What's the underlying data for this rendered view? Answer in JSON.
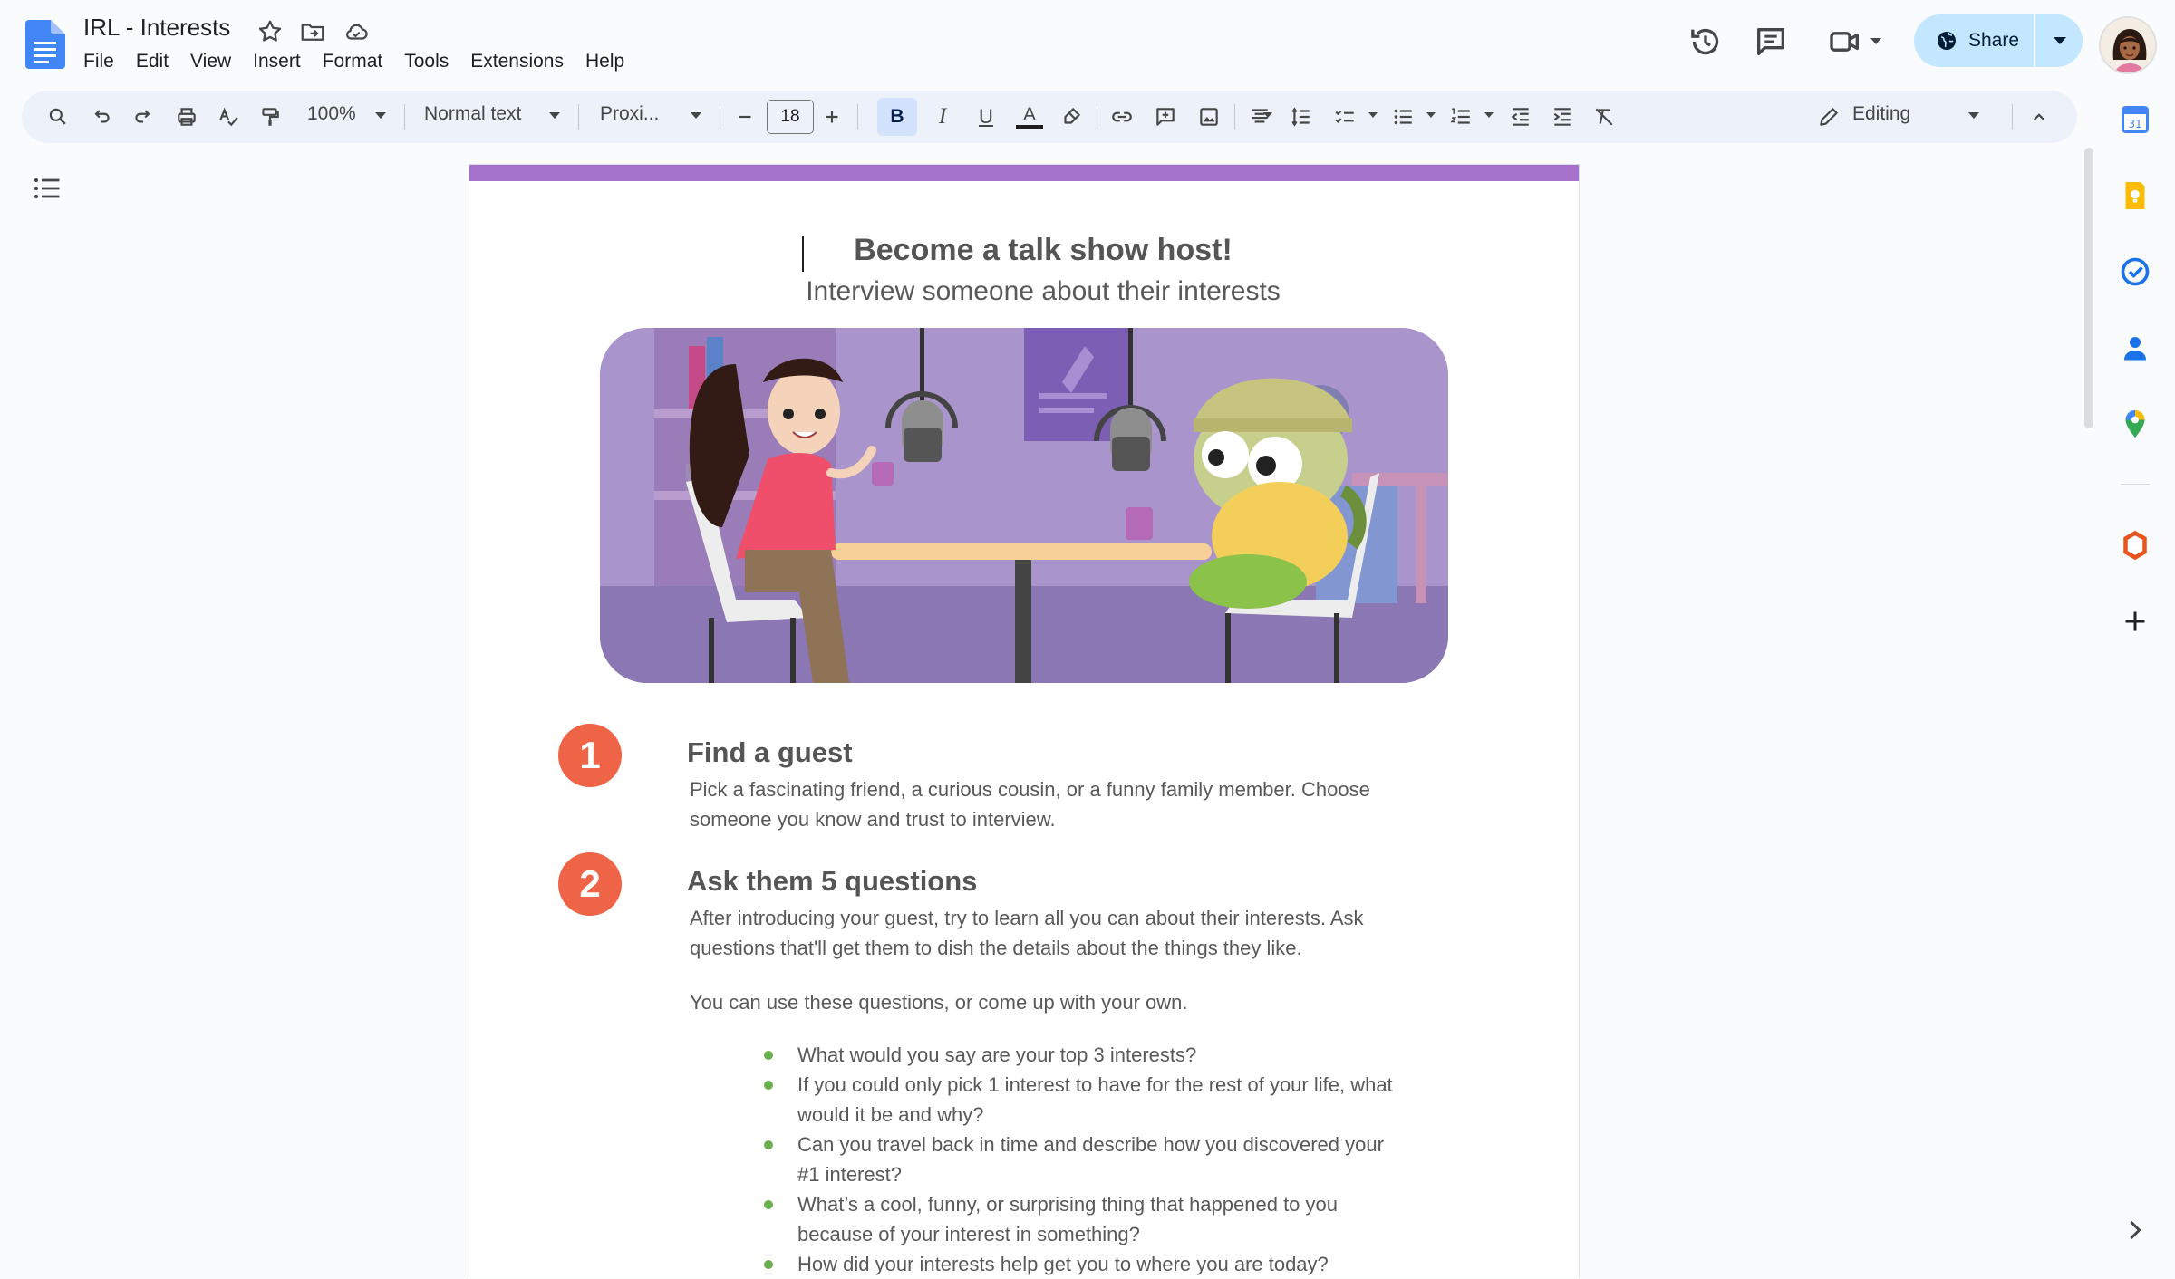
{
  "app": {
    "doc_title": "IRL - Interests",
    "menu": [
      "File",
      "Edit",
      "View",
      "Insert",
      "Format",
      "Tools",
      "Extensions",
      "Help"
    ],
    "share_label": "Share"
  },
  "toolbar": {
    "zoom": "100%",
    "style": "Normal text",
    "font": "Proxi...",
    "font_size": "18",
    "bold": "B",
    "italic": "I",
    "underline": "U",
    "text_color": "A",
    "mode": "Editing"
  },
  "document": {
    "heading": "Become a talk show host!",
    "subheading": "Interview someone about their interests",
    "steps": [
      {
        "number": "1",
        "title": "Find a guest",
        "lines": [
          "Pick a fascinating friend, a curious cousin, or a funny family member. Choose",
          "someone you know and trust to interview."
        ]
      },
      {
        "number": "2",
        "title": "Ask them 5 questions",
        "lines": [
          "After introducing your guest, try to learn all you can about their interests. Ask",
          "questions that'll get them to dish the details about the things they like."
        ]
      }
    ],
    "intro": "You can use these questions, or come up with your own.",
    "questions": [
      [
        "What would you say are your top 3 interests?"
      ],
      [
        "If you could only pick 1 interest to have for the rest of your life, what",
        "would it be and why?"
      ],
      [
        "Can you travel back in time and describe how you discovered your",
        "#1 interest?"
      ],
      [
        "What’s a cool, funny, or surprising thing that happened to you",
        "because of your interest in something?"
      ],
      [
        "How did your interests help get you to where you are today?"
      ]
    ]
  },
  "colors": {
    "accent_band": "#a573cc",
    "step_badge": "#ef6346",
    "bullet": "#6ab04c",
    "share_bg": "#c2e7ff"
  }
}
